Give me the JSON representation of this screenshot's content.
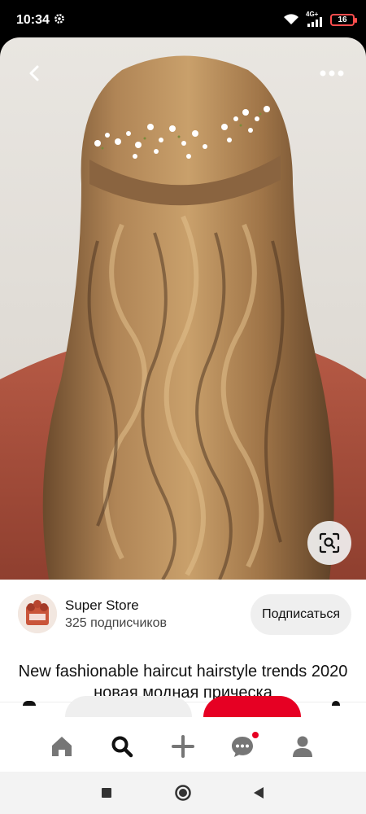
{
  "status_bar": {
    "time": "10:34",
    "network_label": "4G+",
    "battery_level": "16",
    "icons": [
      "gear-icon",
      "wifi-icon",
      "cell-signal-icon",
      "battery-icon"
    ]
  },
  "pin": {
    "image_icon": "hairstyle-photo",
    "actions": [
      "back-icon",
      "more-icon",
      "visual-search-icon"
    ]
  },
  "creator": {
    "name": "Super Store",
    "followers": "325 подписчиков",
    "follow_button": "Подписаться"
  },
  "title": "New fashionable haircut hairstyle trends 2020 новая модная прическа",
  "bottom_nav": {
    "items": [
      "home-icon",
      "search-icon",
      "add-icon",
      "messages-icon",
      "profile-icon"
    ],
    "active": "search-icon",
    "notification_dot_color": "#e60023"
  },
  "system_nav": [
    "recents-icon",
    "home-circle-icon",
    "back-triangle-icon"
  ],
  "colors": {
    "accent": "#e60023",
    "background": "#ffffff",
    "button_gray": "#efefef"
  }
}
